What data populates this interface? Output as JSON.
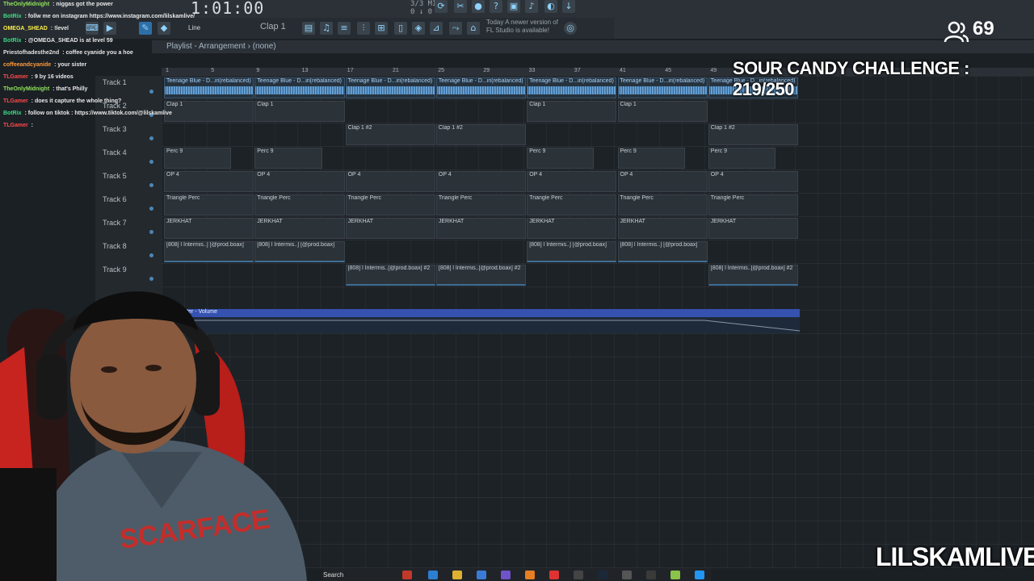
{
  "app": {
    "clock": "1:01:00",
    "bpm_readout": "3/3 MID\n0 ↓ 0",
    "pattern": "Clap 1",
    "snap": "Line",
    "update_notice": "Today  A newer version of FL Studio is available!"
  },
  "playlist": {
    "title": "Playlist - Arrangement",
    "selection": "(none)",
    "ruler_numbers": [
      "1",
      "5",
      "9",
      "13",
      "17",
      "21",
      "25",
      "29",
      "33",
      "37",
      "41",
      "45",
      "49"
    ]
  },
  "tracks": [
    {
      "label": "Track 1"
    },
    {
      "label": "Track 2"
    },
    {
      "label": "Track 3"
    },
    {
      "label": "Track 4"
    },
    {
      "label": "Track 5"
    },
    {
      "label": "Track 6"
    },
    {
      "label": "Track 7"
    },
    {
      "label": "Track 8"
    },
    {
      "label": "Track 9"
    }
  ],
  "clip_names": {
    "audio": "Teenage Blue - D...iri(rebalanced)",
    "clap1": "Clap 1",
    "clap1_2": "Clap 1 #2",
    "perc9": "Perc 9",
    "op4": "OP 4",
    "triangle": "Triangle Perc",
    "jerkhat": "JERKHAT",
    "b808": "[808] l Intermis..] [@prod.boax]",
    "b808_2": "[808] l Intermis..[@prod.boax] #2"
  },
  "automation": {
    "label": "Master - Volume"
  },
  "chat": [
    {
      "user": "TheOnlyMidnight",
      "msg": "niggas got the power",
      "color": "#8fe35a"
    },
    {
      "user": "BotRix",
      "msg": "follw me on instagram https://www.instagram.com/lilskamlive/",
      "color": "#3ddc84"
    },
    {
      "user": "OMEGA_SHEAD",
      "msg": "!level",
      "color": "#fff04a"
    },
    {
      "user": "BotRix",
      "msg": "@OMEGA_SHEAD is at level 59",
      "color": "#3ddc84"
    },
    {
      "user": "Priestofhadesthe2nd",
      "msg": "coffee cyanide you a hoe",
      "color": "#e0e0e0"
    },
    {
      "user": "coffeeandcyanide",
      "msg": "your sister",
      "color": "#ff9a3d"
    },
    {
      "user": "TLGamer",
      "msg": "9 by 16 videos",
      "color": "#ff4a4a"
    },
    {
      "user": "TheOnlyMidnight",
      "msg": "that's Philly",
      "color": "#8fe35a"
    },
    {
      "user": "TLGamer",
      "msg": "does it capture the whole thing?",
      "color": "#ff4a4a"
    },
    {
      "user": "BotRix",
      "msg": "follow on tiktok : https://www.tiktok.com/@lilskamlive",
      "color": "#3ddc84"
    },
    {
      "user": "TLGamer",
      "msg": "",
      "color": "#ff4a4a"
    }
  ],
  "stream": {
    "viewers": "69",
    "challenge": "SOUR CANDY CHALLENGE : 219/250",
    "channel": "LILSKAMLIVE"
  },
  "taskbar": {
    "search": "Search"
  },
  "colors": {
    "accent": "#4fa8f0",
    "automation": "#3552b0",
    "grid": "#1d2227"
  }
}
